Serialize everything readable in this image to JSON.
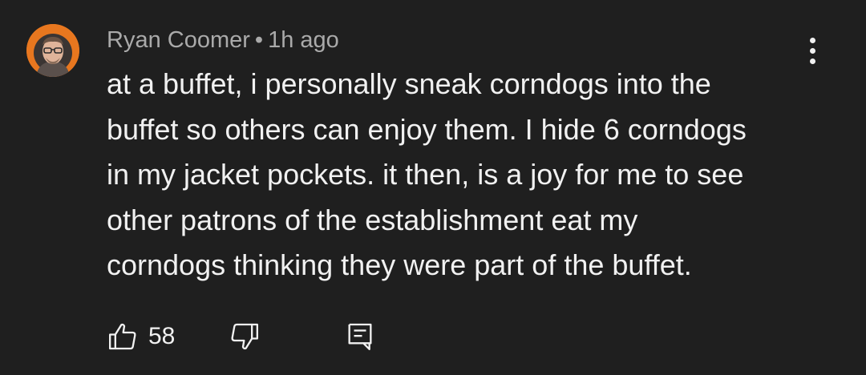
{
  "comment": {
    "author": "Ryan Coomer",
    "separator": "•",
    "timestamp": "1h ago",
    "text_lines": [
      "at a buffet, i personally sneak corndogs into the",
      "buffet so others can enjoy them. I hide 6 corndogs",
      "in my jacket pockets. it then, is a joy for me to see",
      "other patrons of the establishment eat my",
      "corndogs thinking they were part of the buffet."
    ],
    "like_count": "58"
  },
  "icons": {
    "avatar": "user-avatar",
    "menu": "more-vertical-icon",
    "like": "thumbs-up-icon",
    "dislike": "thumbs-down-icon",
    "reply": "reply-comment-icon"
  },
  "colors": {
    "background": "#1f1f1f",
    "primary_text": "#f1f1f1",
    "secondary_text": "#aaaaaa",
    "avatar_ring": "#e8771f"
  }
}
